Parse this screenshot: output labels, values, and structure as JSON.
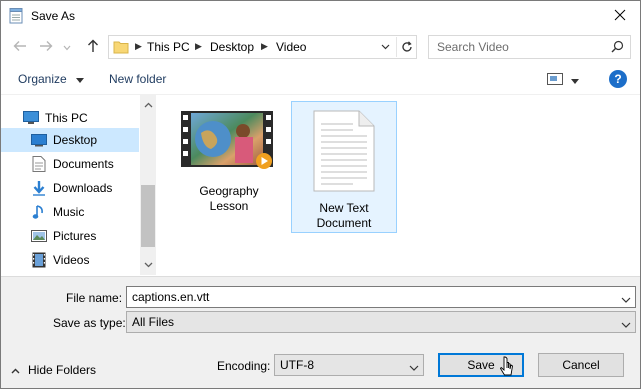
{
  "window": {
    "title": "Save As"
  },
  "nav": {
    "breadcrumb": [
      "This PC",
      "Desktop",
      "Video"
    ],
    "search_placeholder": "Search Video"
  },
  "toolbar": {
    "organize_label": "Organize",
    "new_folder_label": "New folder"
  },
  "sidebar": {
    "items": [
      {
        "label": "This PC",
        "icon": "computer-icon",
        "selected": false
      },
      {
        "label": "Desktop",
        "icon": "desktop-icon",
        "selected": true
      },
      {
        "label": "Documents",
        "icon": "documents-icon",
        "selected": false
      },
      {
        "label": "Downloads",
        "icon": "downloads-icon",
        "selected": false
      },
      {
        "label": "Music",
        "icon": "music-icon",
        "selected": false
      },
      {
        "label": "Pictures",
        "icon": "pictures-icon",
        "selected": false
      },
      {
        "label": "Videos",
        "icon": "videos-icon",
        "selected": false
      }
    ]
  },
  "files": [
    {
      "name": "Geography Lesson",
      "type": "video",
      "selected": false
    },
    {
      "name": "New Text Document",
      "type": "text",
      "selected": true
    }
  ],
  "form": {
    "file_name_label": "File name:",
    "file_name_value": "captions.en.vtt",
    "save_type_label": "Save as type:",
    "save_type_value": "All Files",
    "encoding_label": "Encoding:",
    "encoding_value": "UTF-8"
  },
  "footer": {
    "hide_folders_label": "Hide Folders",
    "save_label": "Save",
    "cancel_label": "Cancel"
  },
  "colors": {
    "accent": "#0078d7",
    "selection": "#cce8ff",
    "help": "#1c6ec9"
  }
}
